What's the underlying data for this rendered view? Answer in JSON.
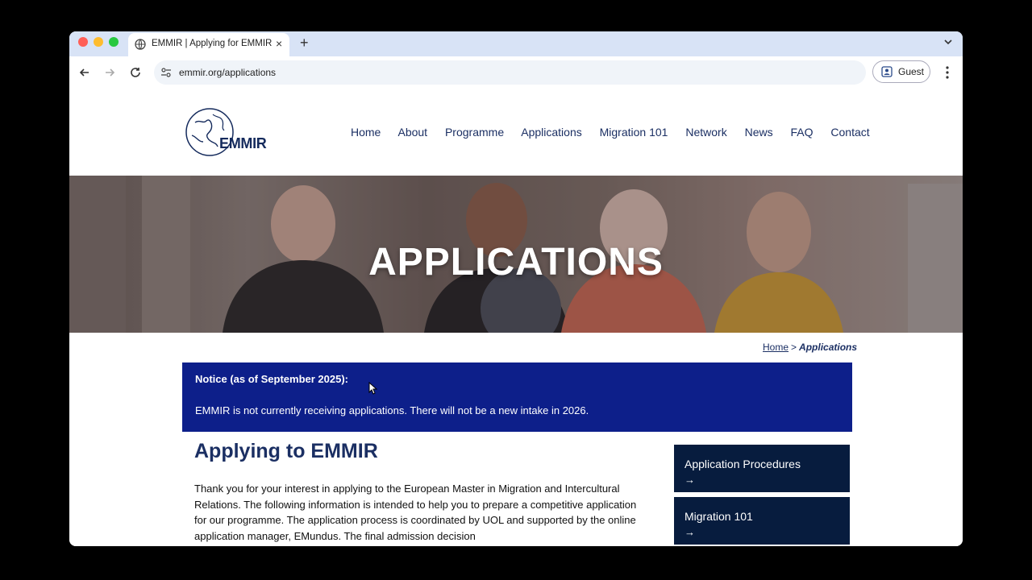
{
  "browser": {
    "tab_title": "EMMIR | Applying for EMMIR",
    "tab_close": "×",
    "new_tab": "+",
    "url": "emmir.org/applications",
    "profile_label": "Guest"
  },
  "site": {
    "logo_text": "EMMIR",
    "nav": [
      "Home",
      "About",
      "Programme",
      "Applications",
      "Migration 101",
      "Network",
      "News",
      "FAQ",
      "Contact"
    ],
    "hero_title": "APPLICATIONS",
    "breadcrumb": {
      "home": "Home",
      "separator": ">",
      "current": "Applications"
    },
    "notice": {
      "title": "Notice (as of September 2025):",
      "body": "EMMIR is not currently receiving applications. There will not be a new intake in 2026."
    },
    "heading": "Applying to EMMIR",
    "paragraph": "Thank you for your interest in applying to the European Master in Migration and Intercultural Relations. The following information is intended to help you to prepare a competitive application for our programme. The application process is coordinated by UOL and supported by the online application manager, EMundus. The final admission decision",
    "sidebar": [
      {
        "label": "Application Procedures",
        "arrow": "→"
      },
      {
        "label": "Migration 101",
        "arrow": "→"
      }
    ]
  },
  "colors": {
    "navy": "#1b2f63",
    "notice_bg": "#0d1f8a",
    "sidebar_bg": "#071c3e",
    "tabbar_bg": "#d8e3f6"
  }
}
